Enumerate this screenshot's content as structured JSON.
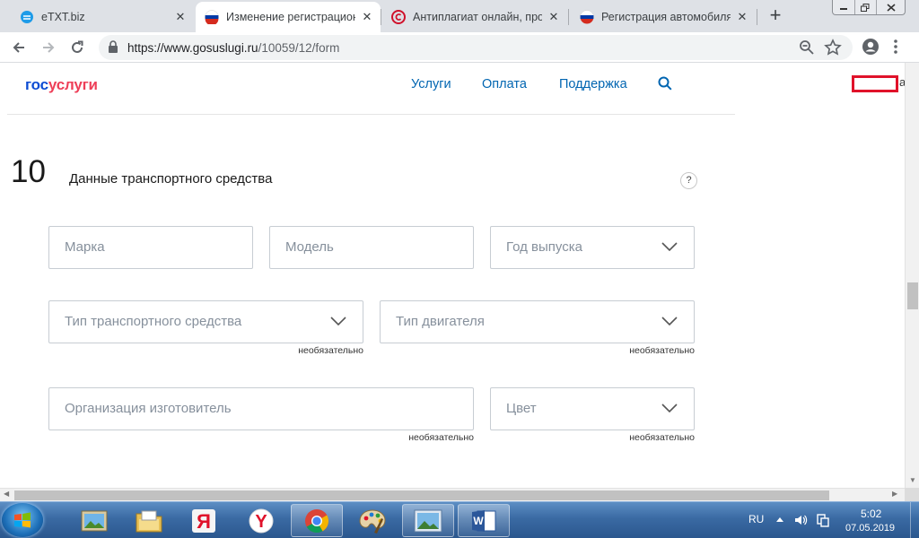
{
  "browser": {
    "tabs": [
      {
        "title": "eTXT.biz",
        "active": false
      },
      {
        "title": "Изменение регистрацион",
        "active": true
      },
      {
        "title": "Антиплагиат онлайн, про",
        "active": false
      },
      {
        "title": "Регистрация автомобиля",
        "active": false
      }
    ],
    "tab_close_glyph": "✕",
    "new_tab_glyph": "+",
    "url_host": "https://www.gosuslugi.ru",
    "url_path": "/10059/12/form"
  },
  "site": {
    "logo_part1": "гос",
    "logo_part2": "услуги",
    "nav": [
      "Услуги",
      "Оплата",
      "Поддержка"
    ],
    "login_trailing_char": "а"
  },
  "form": {
    "step_number": "10",
    "step_title": "Данные транспортного средства",
    "help_glyph": "?",
    "fields": [
      {
        "placeholder": "Марка",
        "type": "input"
      },
      {
        "placeholder": "Модель",
        "type": "input"
      },
      {
        "placeholder": "Год выпуска",
        "type": "select"
      },
      {
        "placeholder": "Тип транспортного средства",
        "type": "select",
        "optional": "необязательно"
      },
      {
        "placeholder": "Тип двигателя",
        "type": "select",
        "optional": "необязательно"
      },
      {
        "placeholder": "Организация изготовитель",
        "type": "input",
        "optional": "необязательно"
      },
      {
        "placeholder": "Цвет",
        "type": "select",
        "optional": "необязательно"
      }
    ]
  },
  "taskbar": {
    "apps": [
      "explorer-photos",
      "file-manager",
      "yandex",
      "yandex-browser",
      "chrome",
      "paint",
      "image-viewer",
      "word"
    ],
    "language": "RU",
    "time": "5:02",
    "date": "07.05.2019"
  },
  "colors": {
    "brand_blue": "#0d4cd3",
    "brand_red": "#ee3f58",
    "link_blue": "#0065b1",
    "highlight_red": "#e0122a"
  }
}
